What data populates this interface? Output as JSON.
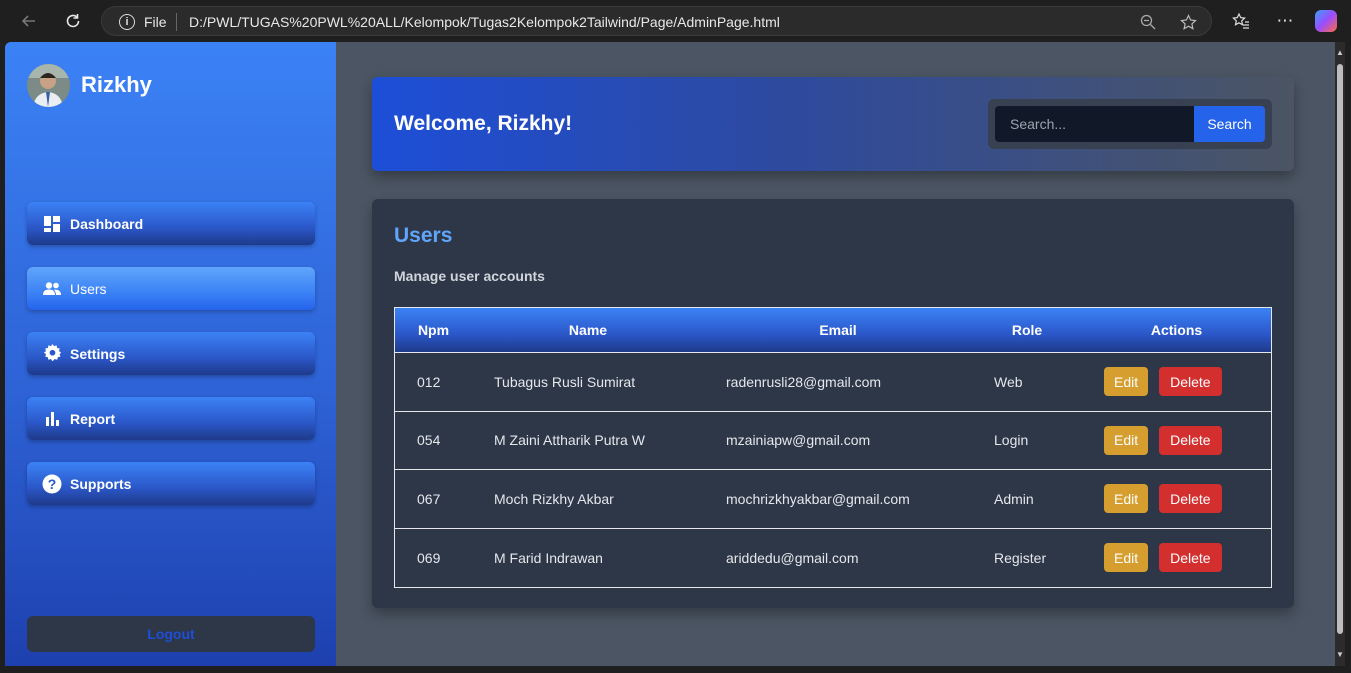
{
  "browser": {
    "file_label": "File",
    "url": "D:/PWL/TUGAS%20PWL%20ALL/Kelompok/Tugas2Kelompok2Tailwind/Page/AdminPage.html",
    "icons": [
      "back-icon",
      "refresh-icon",
      "info-icon",
      "zoom-out-icon",
      "star-icon",
      "favorites-icon",
      "more-icon",
      "copilot-icon"
    ]
  },
  "sidebar": {
    "brand": "Rizkhy",
    "items": [
      {
        "label": "Dashboard",
        "icon": "dashboard-icon"
      },
      {
        "label": "Users",
        "icon": "users-icon",
        "active": true
      },
      {
        "label": "Settings",
        "icon": "gear-icon"
      },
      {
        "label": "Report",
        "icon": "bar-chart-icon"
      },
      {
        "label": "Supports",
        "icon": "question-icon"
      }
    ],
    "logout": "Logout"
  },
  "header": {
    "welcome": "Welcome, Rizkhy!",
    "search_placeholder": "Search...",
    "search_button": "Search"
  },
  "users": {
    "title": "Users",
    "subtitle": "Manage user accounts",
    "columns": [
      "Npm",
      "Name",
      "Email",
      "Role",
      "Actions"
    ],
    "edit_label": "Edit",
    "delete_label": "Delete",
    "rows": [
      {
        "npm": "012",
        "name": "Tubagus Rusli Sumirat",
        "email": "radenrusli28@gmail.com",
        "role": "Web"
      },
      {
        "npm": "054",
        "name": "M Zaini Attharik Putra W",
        "email": "mzainiapw@gmail.com",
        "role": "Login"
      },
      {
        "npm": "067",
        "name": "Moch Rizkhy Akbar",
        "email": "mochrizkhyakbar@gmail.com",
        "role": "Admin"
      },
      {
        "npm": "069",
        "name": "M Farid Indrawan",
        "email": "ariddedu@gmail.com",
        "role": "Register"
      }
    ]
  },
  "colors": {
    "sidebar_top": "#3b82f6",
    "sidebar_bottom": "#1e40af",
    "accent_title": "#60a5fa",
    "edit": "#d69e2e",
    "delete": "#d42f2f",
    "panel": "#2d3748",
    "background": "#4b5563"
  }
}
